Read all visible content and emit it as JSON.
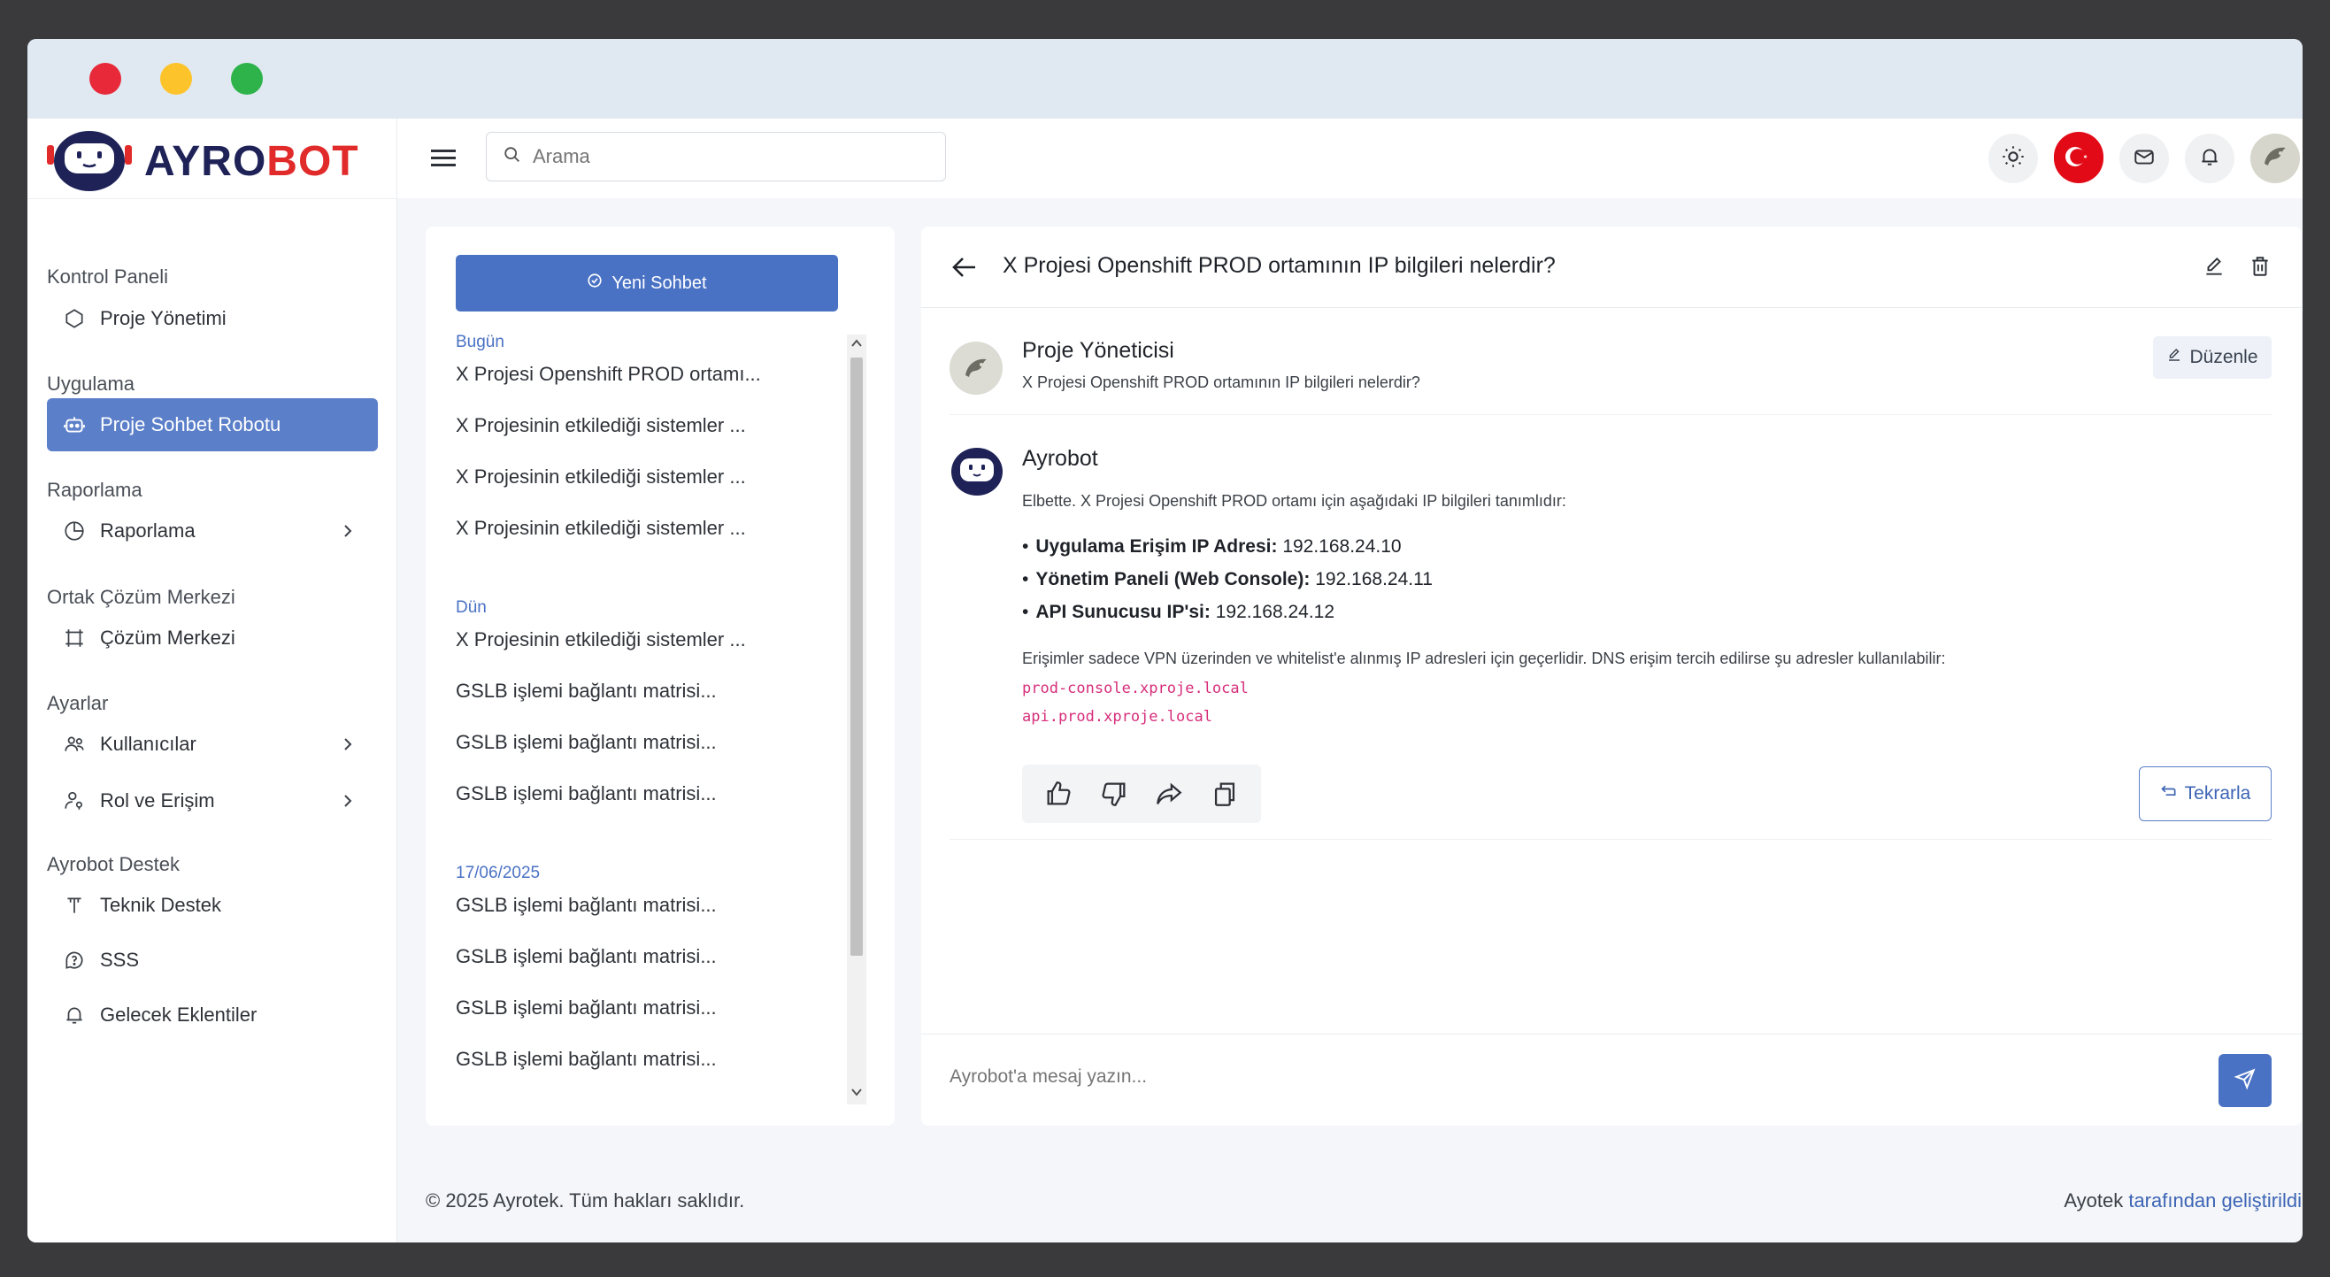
{
  "window": {
    "controls": [
      "close",
      "minimize",
      "maximize"
    ]
  },
  "brand": {
    "name_a": "AYRO",
    "name_b": "BOT",
    "colors": {
      "primary": "#1e2257",
      "accent": "#e12b2b"
    }
  },
  "sidebar": {
    "sections": [
      {
        "title": "Kontrol Paneli",
        "items": [
          {
            "label": "Proje Yönetimi",
            "icon": "dashboard-icon"
          }
        ]
      },
      {
        "title": "Uygulama",
        "items": [
          {
            "label": "Proje Sohbet Robotu",
            "icon": "robot-icon",
            "active": true
          }
        ]
      },
      {
        "title": "Raporlama",
        "items": [
          {
            "label": "Raporlama",
            "icon": "pie-chart-icon",
            "chevron": true
          }
        ]
      },
      {
        "title": "Ortak Çözüm Merkezi",
        "items": [
          {
            "label": "Çözüm Merkezi",
            "icon": "frame-icon"
          }
        ]
      },
      {
        "title": "Ayarlar",
        "items": [
          {
            "label": "Kullanıcılar",
            "icon": "users-icon",
            "chevron": true
          },
          {
            "label": "Rol ve Erişim",
            "icon": "user-key-icon",
            "chevron": true
          }
        ]
      },
      {
        "title": "Ayrobot Destek",
        "items": [
          {
            "label": "Teknik Destek",
            "icon": "support-icon"
          },
          {
            "label": "SSS",
            "icon": "question-icon"
          },
          {
            "label": "Gelecek Eklentiler",
            "icon": "bell-outline-icon"
          }
        ]
      }
    ]
  },
  "header": {
    "search": {
      "placeholder": "Arama",
      "value": ""
    },
    "buttons": [
      "theme-sun-icon",
      "turkey-flag-icon",
      "mail-icon",
      "bell-icon",
      "user-avatar-icon"
    ]
  },
  "chatlist": {
    "new_chat_label": "Yeni Sohbet",
    "groups": [
      {
        "label": "Bugün",
        "items": [
          "X Projesi Openshift PROD ortamı...",
          "X Projesinin etkilediği sistemler ...",
          "X Projesinin etkilediği sistemler ...",
          "X Projesinin etkilediği sistemler ..."
        ]
      },
      {
        "label": "Dün",
        "items": [
          "X Projesinin etkilediği sistemler ...",
          "GSLB işlemi bağlantı matrisi...",
          "GSLB işlemi bağlantı matrisi...",
          "GSLB işlemi bağlantı matrisi..."
        ]
      },
      {
        "label": "17/06/2025",
        "items": [
          "GSLB işlemi bağlantı matrisi...",
          "GSLB işlemi bağlantı matrisi...",
          "GSLB işlemi bağlantı matrisi...",
          "GSLB işlemi bağlantı matrisi..."
        ]
      }
    ]
  },
  "conversation": {
    "title": "X Projesi Openshift PROD ortamının IP bilgileri nelerdir?",
    "user": {
      "name": "Proje Yöneticisi",
      "message": "X Projesi Openshift PROD ortamının IP bilgileri nelerdir?",
      "edit_label": "Düzenle"
    },
    "bot": {
      "name": "Ayrobot",
      "intro": "Elbette. X Projesi Openshift PROD ortamı için aşağıdaki IP bilgileri tanımlıdır:",
      "bullets": [
        {
          "label": "Uygulama Erişim IP Adresi:",
          "value": "192.168.24.10"
        },
        {
          "label": "Yönetim Paneli (Web Console):",
          "value": "192.168.24.11"
        },
        {
          "label": "API Sunucusu IP'si:",
          "value": "192.168.24.12"
        }
      ],
      "note": "Erişimler sadece VPN üzerinden ve whitelist'e alınmış IP adresleri için geçerlidir. DNS erişim tercih edilirse şu adresler kullanılabilir:",
      "code1": "prod-console.xproje.local",
      "code2": "api.prod.xproje.local",
      "retry_label": "Tekrarla"
    },
    "composer": {
      "placeholder": "Ayrobot'a mesaj yazın..."
    }
  },
  "footer": {
    "left": "© 2025 Ayrotek. Tüm hakları saklıdır.",
    "right_a": "Ayotek",
    "right_b": "tarafından geliştirildi"
  }
}
